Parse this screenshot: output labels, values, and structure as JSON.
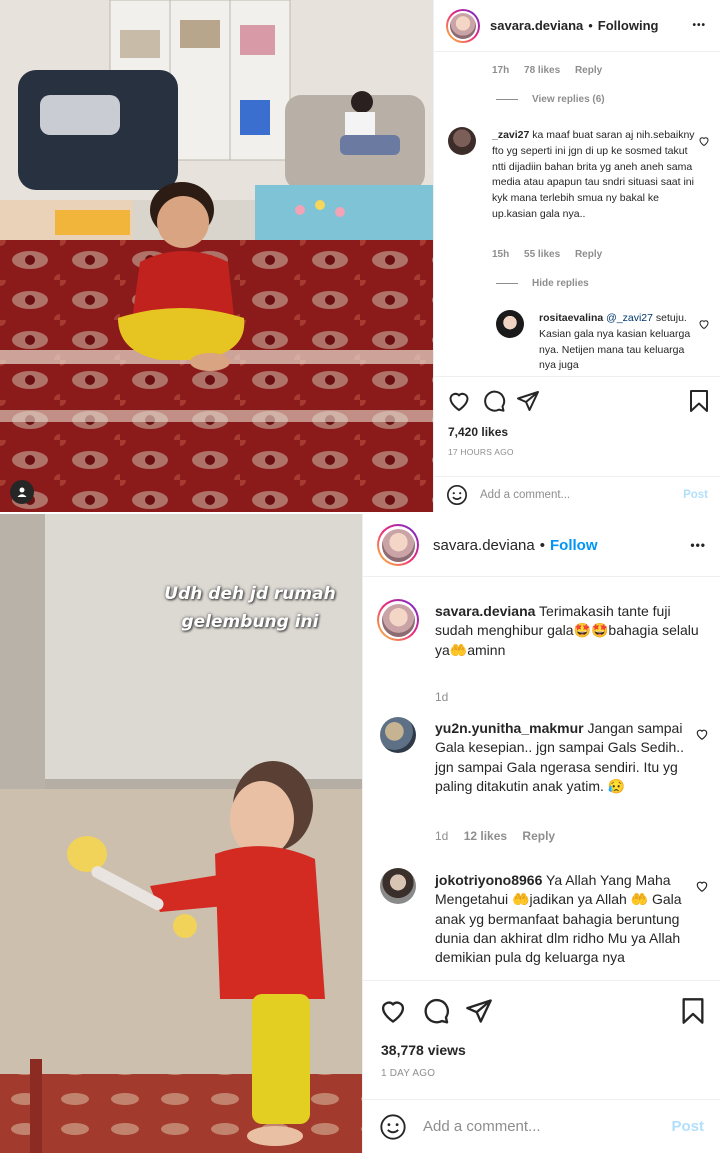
{
  "post1": {
    "header": {
      "username": "savara.deviana",
      "separator": "•",
      "follow_state": "Following",
      "more": "•••"
    },
    "comments": {
      "top_meta": {
        "time": "17h",
        "likes": "78 likes",
        "reply": "Reply"
      },
      "view_replies": "View replies (6)",
      "comment": {
        "username": "_zavi27",
        "text": "ka maaf buat saran aj nih.sebaikny fto yg seperti ini jgn di up ke sosmed takut ntti dijadiin bahan brita yg aneh aneh sama media atau apapun tau sndri situasi saat ini kyk mana terlebih smua ny bakal ke up.kasian gala nya..",
        "time": "15h",
        "likes": "55 likes",
        "reply": "Reply"
      },
      "hide_replies": "Hide replies",
      "reply": {
        "username": "rositaevalina",
        "mention": "@_zavi27",
        "text": "setuju. Kasian gala nya kasian keluarga nya. Netijen mana tau keluarga nya juga"
      }
    },
    "likes": "7,420 likes",
    "time_ago": "17 HOURS AGO",
    "add_comment": {
      "placeholder": "Add a comment...",
      "post": "Post"
    }
  },
  "post2": {
    "header": {
      "username": "savara.deviana",
      "separator": "•",
      "follow_state": "Follow",
      "more": "•••"
    },
    "overlay_text_line1": "Udh deh jd rumah",
    "overlay_text_line2": "gelembung ini",
    "caption": {
      "username": "savara.deviana",
      "text": "Terimakasih tante fuji sudah menghibur gala🤩🤩bahagia selalu ya🤲aminn",
      "time": "1d"
    },
    "comments": [
      {
        "username": "yu2n.yunitha_makmur",
        "text": "Jangan sampai Gala kesepian.. jgn sampai Gals Sedih.. jgn sampai Gala ngerasa sendiri. Itu yg paling ditakutin anak yatim. 😥",
        "time": "1d",
        "likes": "12 likes",
        "reply": "Reply"
      },
      {
        "username": "jokotriyono8966",
        "text": "Ya Allah Yang Maha Mengetahui 🤲jadikan ya Allah 🤲 Gala anak yg bermanfaat bahagia beruntung dunia dan akhirat dlm ridho Mu ya Allah demikian pula dg keluarga nya"
      }
    ],
    "views": "38,778 views",
    "time_ago": "1 DAY AGO",
    "add_comment": {
      "placeholder": "Add a comment...",
      "post": "Post"
    }
  }
}
